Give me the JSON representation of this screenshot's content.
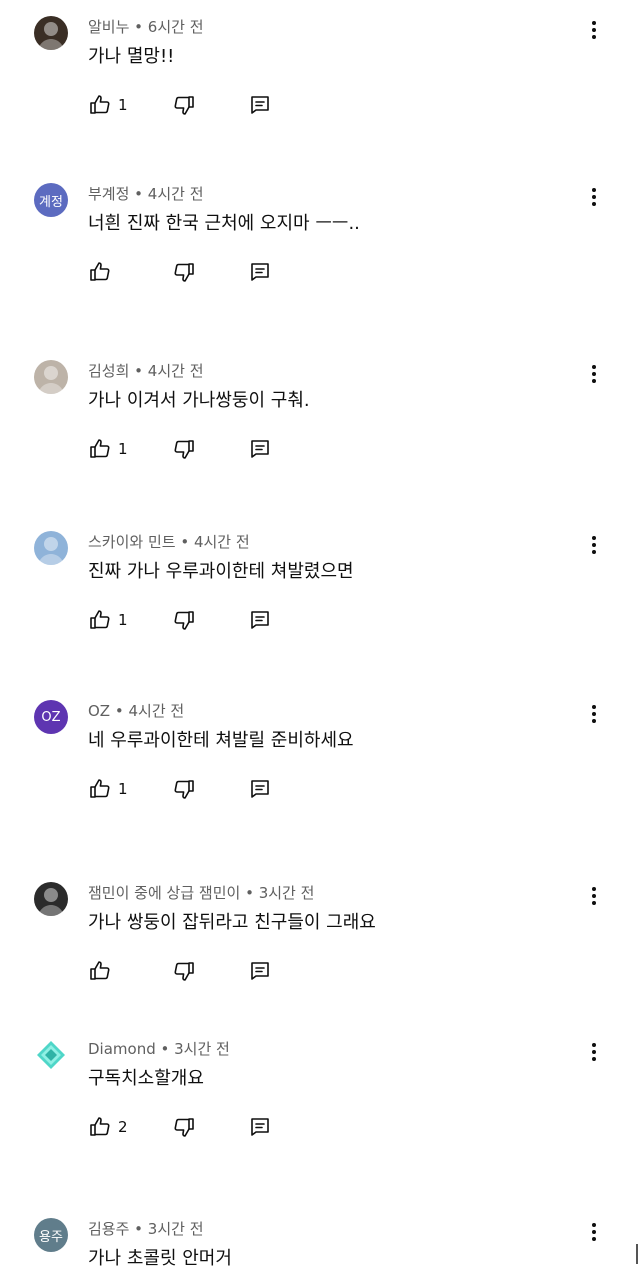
{
  "comments": [
    {
      "author": "알비누",
      "time": "6시간 전",
      "text": "가나 멸망!!",
      "likes": "1",
      "avatar": {
        "type": "photo",
        "bg": "#3a2e25"
      }
    },
    {
      "author": "부계정",
      "time": "4시간 전",
      "text": "너흰 진짜 한국 근처에 오지마 ㅡㅡ..",
      "likes": "",
      "avatar": {
        "type": "initials",
        "label": "계정",
        "bg": "#5c6bc0"
      }
    },
    {
      "author": "김성희",
      "time": "4시간 전",
      "text": "가나 이겨서 가나쌍둥이 구춰.",
      "likes": "1",
      "avatar": {
        "type": "photo",
        "bg": "#bdb3a8"
      }
    },
    {
      "author": "스카이와 민트",
      "time": "4시간 전",
      "text": "진짜  가나 우루과이한테 쳐발렸으면",
      "likes": "1",
      "avatar": {
        "type": "photo",
        "bg": "#8fb3d9"
      }
    },
    {
      "author": "OZ",
      "time": "4시간 전",
      "text": "네 우루과이한테 쳐발릴 준비하세요",
      "likes": "1",
      "avatar": {
        "type": "initials",
        "label": "OZ",
        "bg": "#5e35b1"
      }
    },
    {
      "author": "잼민이 중에 상급 잼민이",
      "time": "3시간 전",
      "text": "가나 쌍둥이 잡뒤라고 친구들이 그래요",
      "likes": "",
      "avatar": {
        "type": "photo",
        "bg": "#2b2b2b"
      }
    },
    {
      "author": "Diamond",
      "time": "3시간 전",
      "text": "구독치소할개요",
      "likes": "2",
      "avatar": {
        "type": "diamond",
        "bg": "#ffffff"
      }
    },
    {
      "author": "김용주",
      "time": "3시간 전",
      "text": "가나 초콜릿 안머거",
      "likes": "",
      "avatar": {
        "type": "initials",
        "label": "용주",
        "bg": "#607d8b"
      }
    }
  ],
  "icons": {
    "like": "thumb-up-icon",
    "dislike": "thumb-down-icon",
    "reply": "reply-icon",
    "more": "more-vert-icon"
  }
}
